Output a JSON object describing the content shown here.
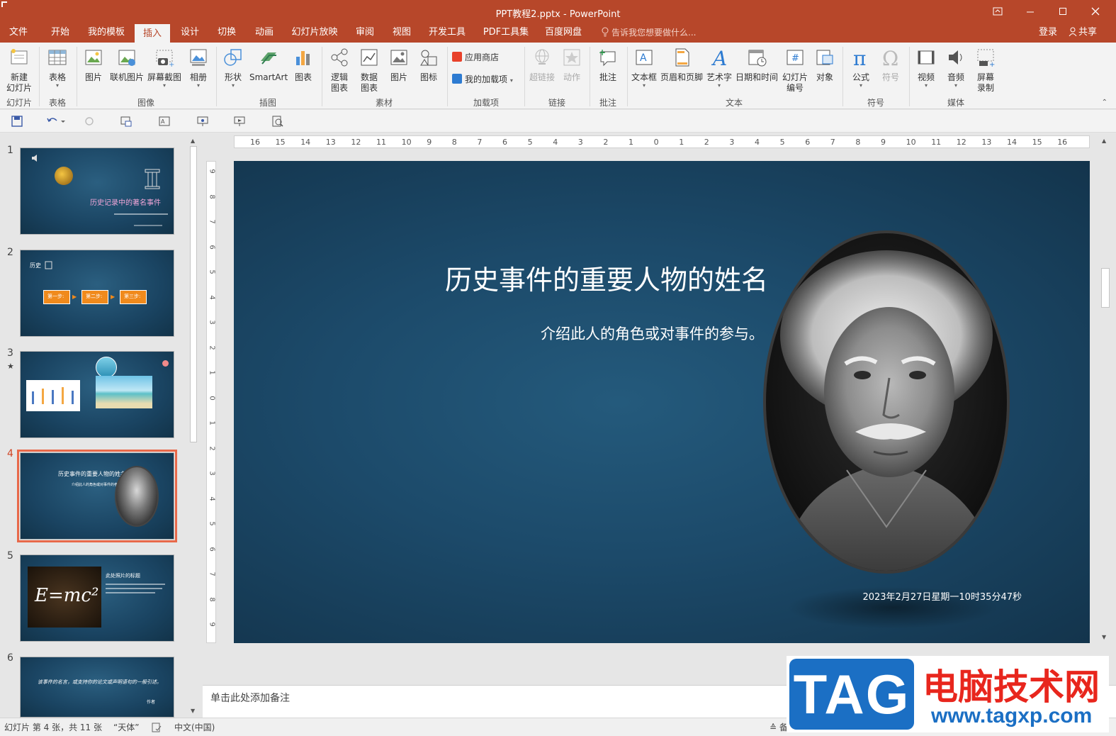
{
  "window": {
    "title": "PPT教程2.pptx - PowerPoint"
  },
  "menu": {
    "tabs": [
      "文件",
      "开始",
      "我的模板",
      "插入",
      "设计",
      "切换",
      "动画",
      "幻灯片放映",
      "审阅",
      "视图",
      "开发工具",
      "PDF工具集",
      "百度网盘"
    ],
    "active": "插入",
    "tell_me": "告诉我您想要做什么...",
    "login": "登录",
    "share": "共享"
  },
  "ribbon": {
    "slides": {
      "new_slide_line1": "新建",
      "new_slide_line2": "幻灯片",
      "group": "幻灯片"
    },
    "table": {
      "label": "表格",
      "group": "表格"
    },
    "images": {
      "picture": "图片",
      "online_picture": "联机图片",
      "screenshot": "屏幕截图",
      "album": "相册",
      "group": "图像"
    },
    "illustrations": {
      "shapes": "形状",
      "smartart": "SmartArt",
      "chart": "图表",
      "group": "插图"
    },
    "material": {
      "logic_chart_1": "逻辑",
      "logic_chart_2": "图表",
      "data_chart_1": "数据",
      "data_chart_2": "图表",
      "picture": "图片",
      "icon": "图标",
      "group": "素材"
    },
    "addins": {
      "store": "应用商店",
      "my_addins": "我的加载项",
      "group": "加载项"
    },
    "links": {
      "hyperlink": "超链接",
      "action": "动作",
      "group": "链接"
    },
    "comments": {
      "comment": "批注",
      "group": "批注"
    },
    "text": {
      "textbox": "文本框",
      "header_footer": "页眉和页脚",
      "wordart": "艺术字",
      "datetime": "日期和时间",
      "slide_number_1": "幻灯片",
      "slide_number_2": "编号",
      "object": "对象",
      "group": "文本"
    },
    "symbols": {
      "equation": "公式",
      "symbol": "符号",
      "group": "符号"
    },
    "media": {
      "video": "视频",
      "audio": "音频",
      "screen_rec_1": "屏幕",
      "screen_rec_2": "录制",
      "group": "媒体"
    }
  },
  "ruler": {
    "h_labels": [
      "16",
      "15",
      "14",
      "13",
      "12",
      "11",
      "10",
      "9",
      "8",
      "7",
      "6",
      "5",
      "4",
      "3",
      "2",
      "1",
      "0",
      "1",
      "2",
      "3",
      "4",
      "5",
      "6",
      "7",
      "8",
      "9",
      "10",
      "11",
      "12",
      "13",
      "14",
      "15",
      "16"
    ],
    "v_labels": [
      "9",
      "8",
      "7",
      "6",
      "5",
      "4",
      "3",
      "2",
      "1",
      "0",
      "1",
      "2",
      "3",
      "4",
      "5",
      "6",
      "7",
      "8",
      "9"
    ]
  },
  "thumbnails": {
    "nums": [
      "1",
      "2",
      "3",
      "4",
      "5",
      "6"
    ],
    "s1_title": "历史记录中的著名事件",
    "s2_label": "历史",
    "s2_step1": "第一步:",
    "s2_step2": "第二步:",
    "s2_step3": "第三步:",
    "s4_title": "历史事件的重要人物的姓名",
    "s4_sub": "介绍此人的角色或对事件的参与。",
    "s5_title": "此处照片的标题",
    "s5_formula": "E=mc²",
    "s6_text": "该事件的名言，或支持你的论文或声明语句的一般引述。",
    "s6_author": "作者"
  },
  "slide": {
    "title": "历史事件的重要人物的姓名",
    "subtitle": "介绍此人的角色或对事件的参与。",
    "date": "2023年2月27日星期一10时35分47秒"
  },
  "notes": {
    "placeholder": "单击此处添加备注"
  },
  "status": {
    "slide_info": "幻灯片 第 4 张，共 11 张",
    "theme": "“天体”",
    "language": "中文(中国)",
    "notes_btn": "备"
  },
  "watermark": {
    "tag": "TAG",
    "name": "电脑技术网",
    "url": "www.tagxp.com"
  },
  "colors": {
    "accent": "#b7472a",
    "slide_bg": "#1c4a6a",
    "thumb_active": "#e8694a",
    "step_box": "#f08a1c"
  }
}
